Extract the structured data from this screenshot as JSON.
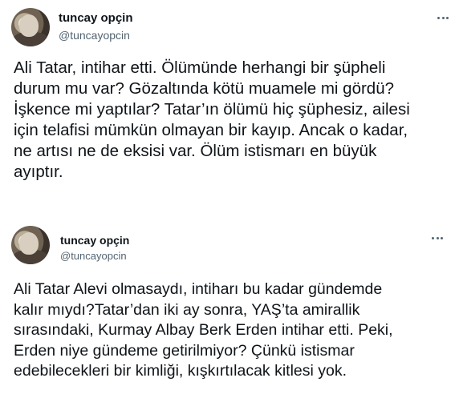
{
  "tweets": [
    {
      "author_name": "tuncay opçin",
      "author_handle": "@tuncayopcin",
      "more_icon": "more-horizontal-icon",
      "text": "Ali Tatar, intihar etti. Ölümünde herhangi bir şüpheli\ndurum mu var? Gözaltında kötü muamele mi gördü?\nİşkence mi yaptılar? Tatar’ın ölümü hiç şüphesiz, ailesi\niçin telafisi mümkün olmayan bir kayıp. Ancak o kadar,\nne artısı ne de eksisi var. Ölüm istismarı en büyük\nayıptır."
    },
    {
      "author_name": "tuncay opçin",
      "author_handle": "@tuncayopcin",
      "more_icon": "more-horizontal-icon",
      "text": "Ali Tatar Alevi olmasaydı, intiharı bu kadar gündemde\nkalır mıydı?Tatar’dan iki ay sonra, YAŞ’ta amirallik\nsırasındaki, Kurmay Albay Berk Erden intihar etti. Peki,\nErden niye gündeme getirilmiyor? Çünkü istismar\nedebilecekleri bir kimliği, kışkırtılacak kitlesi yok."
    }
  ]
}
